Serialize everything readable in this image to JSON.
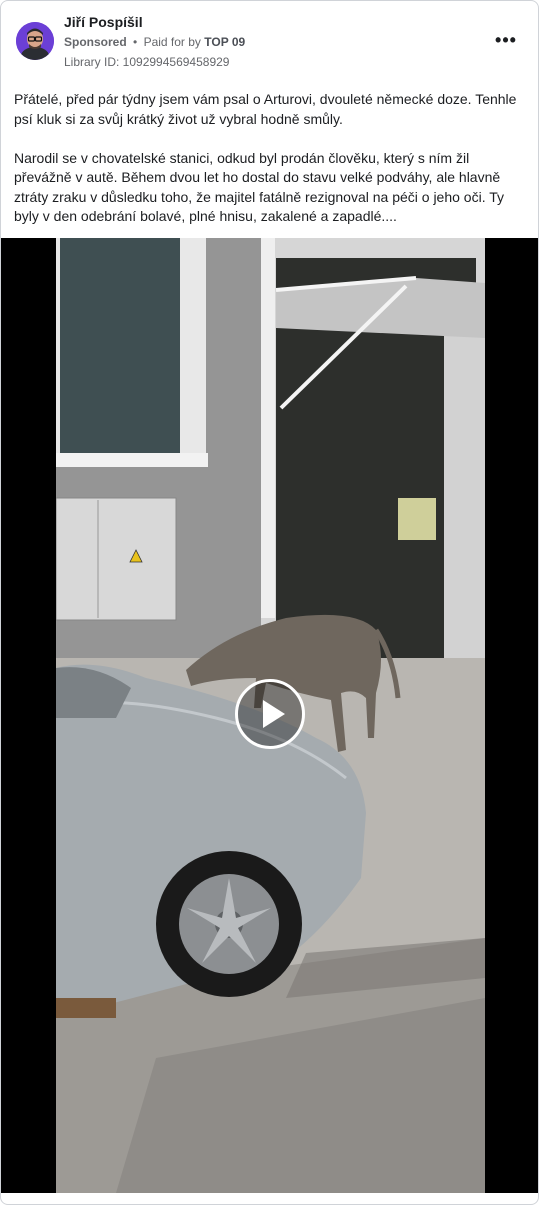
{
  "post": {
    "author": "Jiří Pospíšil",
    "sponsored_label": "Sponsored",
    "separator": "•",
    "paid_for_label": "Paid for by",
    "payer": "TOP 09",
    "library_id": "Library ID: 1092994569458929",
    "more_icon": "more-horizontal-icon",
    "avatar_icon": "person-avatar",
    "paragraphs": [
      "Přátelé, před pár týdny jsem vám psal o Arturovi, dvouleté německé doze. Tenhle psí kluk si za svůj krátký život už vybral hodně smůly.",
      "Narodil se v chovatelské stanici, odkud byl prodán člověku, který s ním žil převážně v autě. Během dvou let ho dostal do stavu velké podváhy, ale hlavně ztráty zraku v důsledku toho, že majitel fatálně rezignoval na péči o jeho oči. Ty byly v den odebrání bolavé, plné hnisu, zakalené a zapadlé...."
    ]
  },
  "video": {
    "play_icon": "play-icon",
    "colors": {
      "letterbox": "#000000",
      "wall": "#8e8e8e",
      "asphalt": "#b9b6b1",
      "car": "#a5abaf"
    }
  }
}
